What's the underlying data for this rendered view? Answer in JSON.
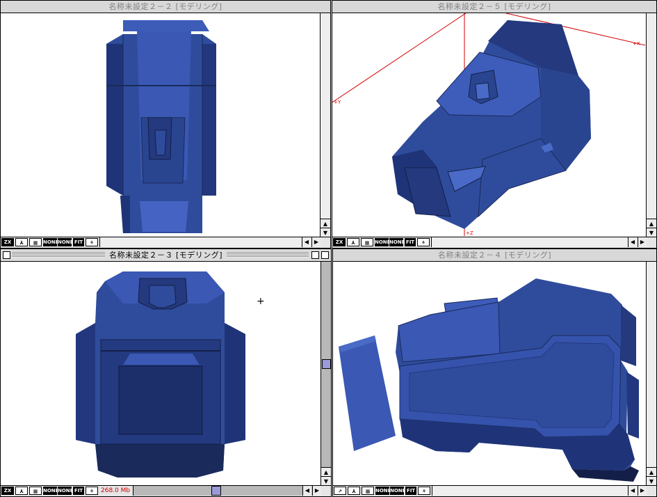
{
  "windows": {
    "top_left": {
      "title": "名称未設定２－２ [モデリング]"
    },
    "top_right": {
      "title": "名称未設定２－５ [モデリング]"
    },
    "bottom_left": {
      "title": "名称未設定２－３ [モデリング]"
    },
    "bottom_right": {
      "title": "名称未設定２－４ [モデリング]"
    }
  },
  "statusbar": {
    "axis_label": "ZX",
    "none_label_1": "NONE",
    "none_label_2": "NONE",
    "fit_label": "FIT",
    "memory": "268.0 Mb"
  },
  "perspective_axes": {
    "x_label": "+X",
    "y_label": "+Y",
    "z_label": "+Z"
  },
  "colors": {
    "model_base": "#2f4c9c",
    "model_dark": "#1a2a5a",
    "model_light": "#4a6ac8",
    "axis_red": "#d00000",
    "memory_red": "#d00000"
  }
}
